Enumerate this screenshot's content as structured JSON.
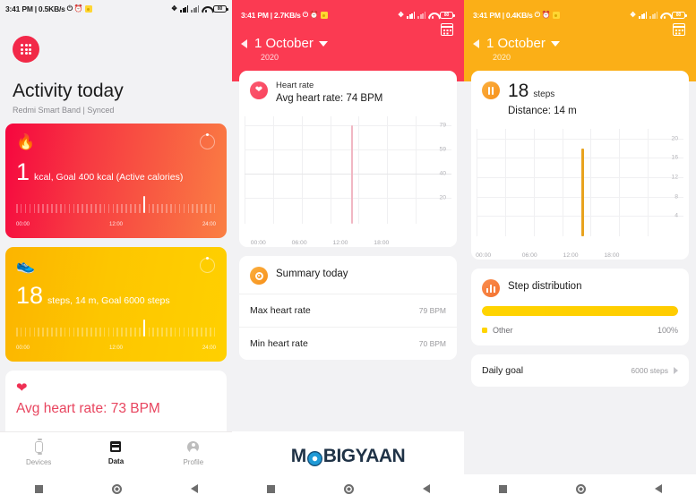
{
  "screens": {
    "activity": {
      "status_bar": {
        "time": "3:41 PM",
        "separator": "|",
        "net_speed": "0.5KB/s"
      },
      "app_icon": "app-grid-icon",
      "title": "Activity today",
      "subtitle": "Redmi Smart Band | Synced",
      "calories_card": {
        "icon": "flame-icon",
        "value": "1",
        "unit": "kcal, Goal 400 kcal (Active calories)",
        "axis_start": "00:00",
        "axis_mid": "12:00",
        "axis_end": "24:00"
      },
      "steps_card": {
        "icon": "shoe-icon",
        "value": "18",
        "unit": "steps, 14 m, Goal 6000 steps",
        "axis_start": "00:00",
        "axis_mid": "12:00",
        "axis_end": "24:00"
      },
      "heart_card": {
        "icon": "heart-icon",
        "text": "Avg heart rate: 73 BPM"
      },
      "bottom_nav": [
        {
          "icon": "watch-icon",
          "label": "Devices",
          "active": false
        },
        {
          "icon": "data-icon",
          "label": "Data",
          "active": true
        },
        {
          "icon": "person-icon",
          "label": "Profile",
          "active": false
        }
      ]
    },
    "heart_rate": {
      "status_bar": {
        "time": "3:41 PM",
        "separator": "|",
        "net_speed": "2.7KB/s"
      },
      "header": {
        "date": "1 October",
        "year": "2020",
        "back_icon": "chevron-left-icon",
        "dropdown_icon": "caret-down-icon",
        "calendar_icon": "calendar-icon"
      },
      "card": {
        "icon": "heart-circle-icon",
        "title": "Heart rate",
        "subtitle": "Avg heart rate: 74 BPM"
      },
      "summary": {
        "icon": "eye-circle-icon",
        "title": "Summary today",
        "rows": [
          {
            "label": "Max heart rate",
            "value": "79 BPM"
          },
          {
            "label": "Min heart rate",
            "value": "70 BPM"
          }
        ]
      }
    },
    "steps": {
      "status_bar": {
        "time": "3:41 PM",
        "separator": "|",
        "net_speed": "0.4KB/s"
      },
      "header": {
        "date": "1 October",
        "year": "2020",
        "back_icon": "chevron-left-icon",
        "dropdown_icon": "caret-down-icon",
        "calendar_icon": "calendar-icon"
      },
      "card": {
        "icon": "pause-circle-icon",
        "value": "18",
        "unit": "steps",
        "distance": "Distance: 14 m"
      },
      "distribution": {
        "icon": "bars-circle-icon",
        "title": "Step distribution",
        "legend_label": "Other",
        "legend_pct": "100%",
        "fill_percent": 100
      },
      "daily_goal": {
        "label": "Daily goal",
        "value": "6000 steps",
        "chevron": "chevron-right-icon"
      }
    }
  },
  "watermark": {
    "part1": "M",
    "part2": "BIGYAAN"
  },
  "colors": {
    "red": "#fb3a52",
    "amber": "#fbaf17",
    "yellow": "#ffd400",
    "heart_pink": "#ef3054",
    "bg": "#f2f2f4"
  },
  "chart_data": [
    {
      "type": "bar",
      "title": "Heart rate",
      "xlabel": "",
      "ylabel": "BPM",
      "x": [
        "00:00",
        "06:00",
        "12:00",
        "18:00"
      ],
      "tick_labels_y": [
        "79",
        "59",
        "40",
        "20"
      ],
      "ylim": [
        0,
        86
      ],
      "grid": true,
      "legend": "none",
      "bars": [
        {
          "time": "15:00",
          "value": 79
        }
      ],
      "annotations": [
        "Avg heart rate: 74 BPM",
        "Max heart rate 79 BPM",
        "Min heart rate 70 BPM"
      ]
    },
    {
      "type": "bar",
      "title": "Steps",
      "xlabel": "",
      "ylabel": "steps",
      "x": [
        "00:00",
        "06:00",
        "12:00",
        "18:00"
      ],
      "tick_labels_y": [
        "20",
        "16",
        "12",
        "8",
        "4"
      ],
      "ylim": [
        0,
        22
      ],
      "grid": true,
      "legend": "none",
      "bars": [
        {
          "time": "15:00",
          "value": 18
        }
      ],
      "annotations": [
        "18 steps",
        "Distance: 14 m"
      ]
    },
    {
      "type": "bar",
      "title": "Step distribution",
      "categories": [
        "Other"
      ],
      "values": [
        100
      ],
      "unit": "%",
      "colors": [
        "#ffd400"
      ],
      "legend": "bottom"
    }
  ]
}
